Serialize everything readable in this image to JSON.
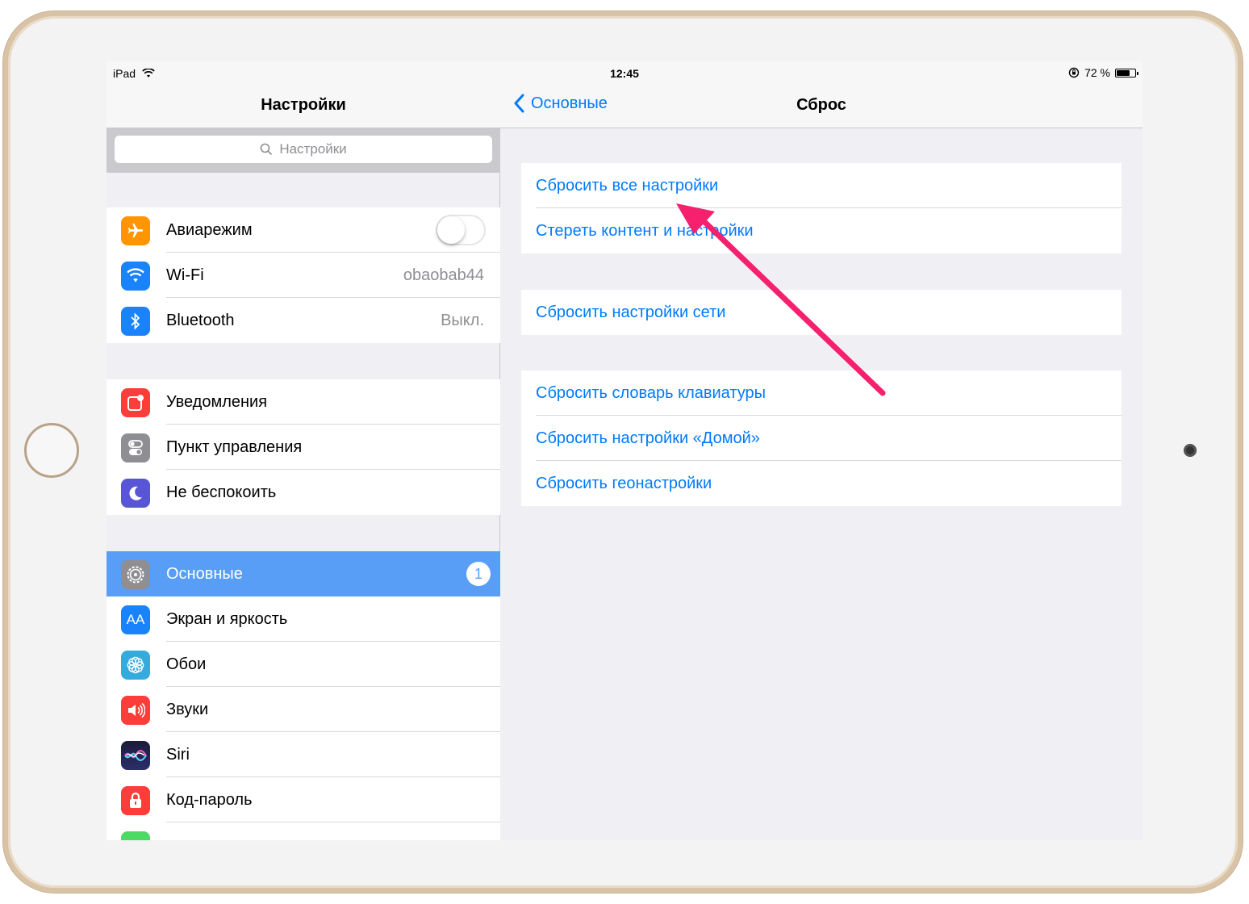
{
  "status_bar": {
    "device": "iPad",
    "time": "12:45",
    "battery": "72 %",
    "battery_level": 0.72
  },
  "sidebar": {
    "title": "Настройки",
    "search_placeholder": "Настройки",
    "group1": [
      {
        "label": "Авиарежим",
        "icon": "airplane-icon",
        "color": "#ff9500",
        "toggle": false
      },
      {
        "label": "Wi-Fi",
        "icon": "wifi-icon",
        "color": "#1a82fb",
        "value": "obaobab44"
      },
      {
        "label": "Bluetooth",
        "icon": "bluetooth-icon",
        "color": "#1a82fb",
        "value": "Выкл."
      }
    ],
    "group2": [
      {
        "label": "Уведомления",
        "icon": "notifications-icon",
        "color": "#fc3d39"
      },
      {
        "label": "Пункт управления",
        "icon": "control-center-icon",
        "color": "#8e8e93"
      },
      {
        "label": "Не беспокоить",
        "icon": "moon-icon",
        "color": "#5856d6"
      }
    ],
    "group3": [
      {
        "label": "Основные",
        "icon": "gear-icon",
        "color": "#8e8e93",
        "badge": "1",
        "selected": true
      },
      {
        "label": "Экран и яркость",
        "icon": "text-size-icon",
        "color": "#1a82fb",
        "glyph": "AA"
      },
      {
        "label": "Обои",
        "icon": "wallpaper-flower-icon",
        "color": "#35aadc"
      },
      {
        "label": "Звуки",
        "icon": "speaker-icon",
        "color": "#fc3d39"
      },
      {
        "label": "Siri",
        "icon": "siri-icon",
        "color": "#1b1b3a"
      },
      {
        "label": "Код-пароль",
        "icon": "lock-icon",
        "color": "#fc3d39"
      }
    ]
  },
  "detail": {
    "back_label": "Основные",
    "title": "Сброс",
    "group1": [
      "Сбросить все настройки",
      "Стереть контент и настройки"
    ],
    "group2": [
      "Сбросить настройки сети"
    ],
    "group3": [
      "Сбросить словарь клавиатуры",
      "Сбросить настройки «Домой»",
      "Сбросить геонастройки"
    ]
  },
  "colors": {
    "accent": "#007aff",
    "selected_row": "#589ef7",
    "annotation_arrow": "#f5206e"
  }
}
